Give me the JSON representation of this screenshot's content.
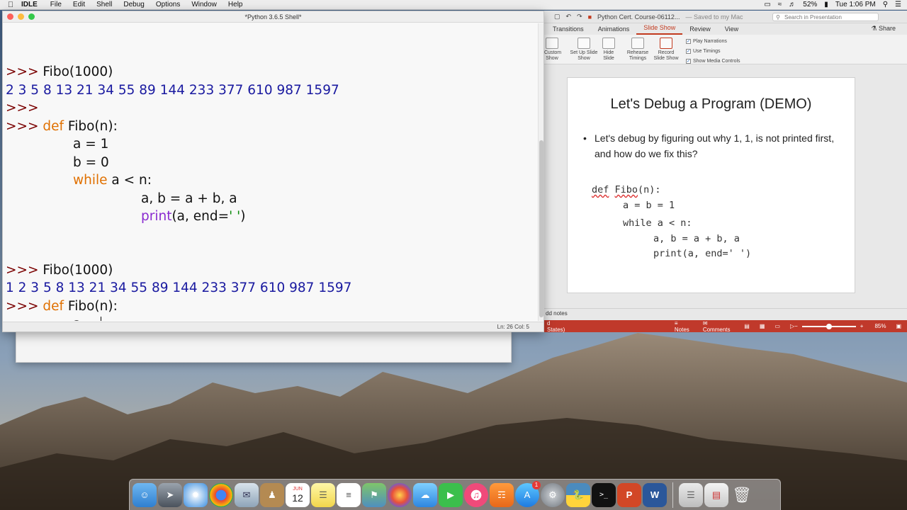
{
  "menubar": {
    "app_name": "IDLE",
    "items": [
      "File",
      "Edit",
      "Shell",
      "Debug",
      "Options",
      "Window",
      "Help"
    ],
    "battery": "52%",
    "clock": "Tue 1:06 PM"
  },
  "idle": {
    "title": "*Python 3.6.5 Shell*",
    "status": "Ln: 26   Col: 5",
    "lines": {
      "l1_prompt": ">>> ",
      "l1_call": "Fibo(1000)",
      "l2_out": "2 3 5 8 13 21 34 55 89 144 233 377 610 987 1597",
      "l3_prompt": ">>>",
      "l4_prompt": ">>> ",
      "l4_def": "def",
      "l4_rest": " Fibo(n):",
      "l5": "a = 1",
      "l6": "b = 0",
      "l7_kw": "while",
      "l7_rest": " a < n:",
      "l8": "a, b = a + b, a",
      "l9_fn": "print",
      "l9_a": "(a, end=",
      "l9_str": "' '",
      "l9_b": ")",
      "l10_prompt": ">>> ",
      "l10_call": "Fibo(1000)",
      "l11_out": "1 2 3 5 8 13 21 34 55 89 144 233 377 610 987 1597",
      "l12_prompt": ">>> ",
      "l12_def": "def",
      "l12_rest": " Fibo(n):",
      "l13": "a = "
    }
  },
  "ppt": {
    "title": "Python Cert. Course-06112...",
    "saved": "— Saved to my Mac",
    "search_placeholder": "Search in Presentation",
    "tabs": [
      "Transitions",
      "Animations",
      "Slide Show",
      "Review",
      "View"
    ],
    "active_tab": "Slide Show",
    "share": "Share",
    "ribbon": {
      "custom_show": "Custom Show",
      "setup": "Set Up Slide Show",
      "hide": "Hide Slide",
      "rehearse": "Rehearse Timings",
      "record": "Record Slide Show",
      "play_narrations": "Play Narrations",
      "use_timings": "Use Timings",
      "show_media": "Show Media Controls"
    },
    "slide": {
      "title": "Let's Debug a Program (DEMO)",
      "bullet": "Let's debug by figuring out why 1, 1, is not printed first, and how do we fix this?",
      "code_def": "def",
      "code_fn": "Fibo",
      "code_sig": "(n):",
      "code2": "a = b = 1",
      "code3": "while a < n:",
      "code4": "a, b = a + b, a",
      "code5": "print(a, end=' ')"
    },
    "notes_label": "dd notes",
    "status": {
      "lang": "d States)",
      "notes": "Notes",
      "comments": "Comments",
      "zoom": "85%"
    }
  },
  "dock": {
    "calendar_day": "12",
    "calendar_month": "JUN",
    "badge": "1"
  }
}
